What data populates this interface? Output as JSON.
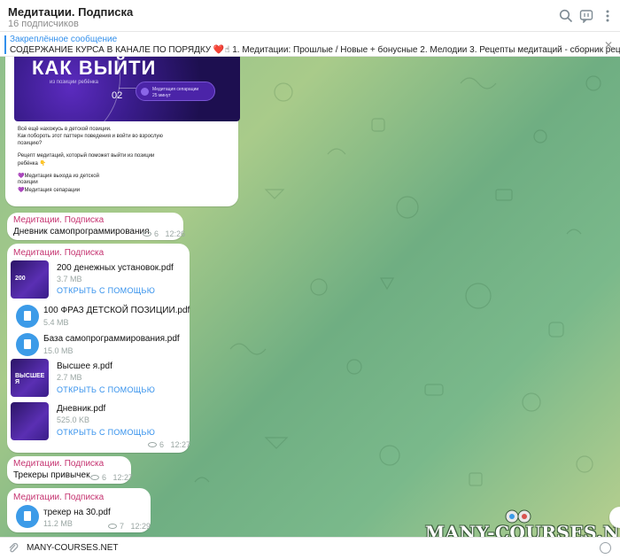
{
  "header": {
    "title": "Медитации. Подписка",
    "subtitle": "16 подписчиков",
    "icons": [
      "search-icon",
      "comments-icon",
      "more-icon"
    ]
  },
  "pinned": {
    "title": "Закреплённое сообщение",
    "text": "СОДЕРЖАНИЕ КУРСА В КАНАЛЕ ПО ПОРЯДКУ ❤️☝ 1. Медитации: Прошлые / Новые + бонусные  2. Мелодии  3. Рецепты медитаций - сборник рецептов на все случаи жиз..."
  },
  "image_post": {
    "headline": "КАК ВЫЙТИ",
    "headline_sub": "из позиции ребёнка",
    "step": "02",
    "pill_title": "Медитация сепарации",
    "pill_sub": "25 минут",
    "lines": [
      "Всё ещё нахожусь в детской позиции.",
      "Как побороть этот паттерн поведения и войти во взрослую",
      "позицию?",
      "",
      "Рецепт медитаций, который поможет выйти из позиции",
      "ребёнка 👇",
      "",
      "💜Медитация выхода из детской",
      "позиции",
      "💜Медитация сепарации"
    ]
  },
  "messages": [
    {
      "sender": "Медитации. Подписка",
      "text": "Дневник самопрограммирования",
      "views": "6",
      "time": "12:26"
    },
    {
      "sender": "Медитации. Подписка",
      "views": "6",
      "time": "12:27",
      "files": [
        {
          "name": "200 денежных установок.pdf",
          "size": "3.7 MB",
          "link": "ОТКРЫТЬ С ПОМОЩЬЮ",
          "thumb_text": "200"
        },
        {
          "name": "100 ФРАЗ ДЕТСКОЙ ПОЗИЦИИ.pdf",
          "size": "5.4 MB"
        },
        {
          "name": "База самопрограммирования.pdf",
          "size": "15.0 MB"
        },
        {
          "name": "Высшее я.pdf",
          "size": "2.7 MB",
          "link": "ОТКРЫТЬ С ПОМОЩЬЮ",
          "thumb_text": "ВЫСШЕЕ Я"
        },
        {
          "name": "Дневник.pdf",
          "size": "525.0 KB",
          "link": "ОТКРЫТЬ С ПОМОЩЬЮ",
          "thumb_text": ""
        }
      ]
    },
    {
      "sender": "Медитации. Подписка",
      "text": "Трекеры привычек",
      "views": "6",
      "time": "12:27"
    },
    {
      "sender": "Медитации. Подписка",
      "views": "7",
      "time": "12:29",
      "files": [
        {
          "name": "трекер на 30.pdf",
          "size": "11.2 MB"
        }
      ]
    }
  ],
  "watermark": "MANY-COURSES.NET",
  "composer": {
    "text": "MANY-COURSES.NET"
  },
  "colors": {
    "accent": "#3390ec",
    "sender": "#c53370",
    "wallpaper": "#8fc08b"
  }
}
